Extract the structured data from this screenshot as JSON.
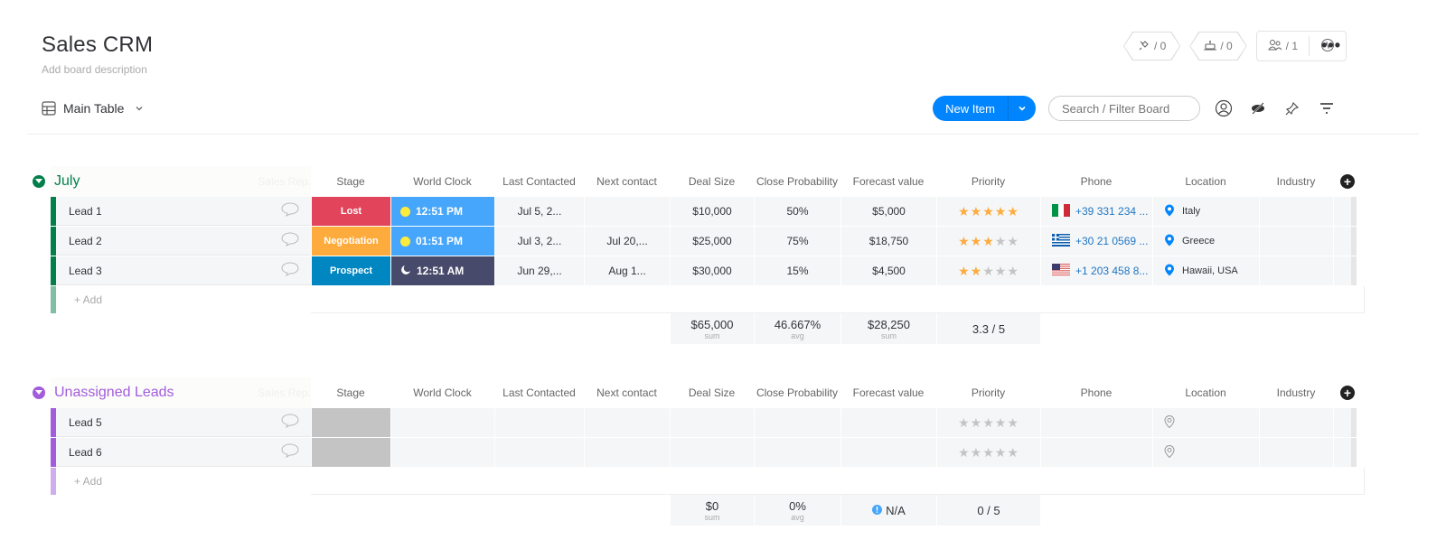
{
  "board": {
    "title": "Sales CRM",
    "description": "Add board description",
    "view": "Main Table"
  },
  "top_actions": {
    "integrations_count": "/ 0",
    "automations_count": "/ 0",
    "members_count": "/ 1"
  },
  "toolbar": {
    "new_item": "New Item",
    "search_placeholder": "Search / Filter Board"
  },
  "columns": [
    "Stage",
    "World Clock",
    "Last Contacted",
    "Next contact",
    "Deal Size",
    "Close Probability",
    "Forecast value",
    "Priority",
    "Phone",
    "Location",
    "Industry"
  ],
  "sales_rep_label": "Sales Rep.",
  "groups": [
    {
      "title": "July",
      "color": "#037f4c",
      "items": [
        {
          "name": "Lead 1",
          "stage": "Lost",
          "stage_color": "#e2445c",
          "clock": "12:51 PM",
          "clock_icon": "sun",
          "clock_color": "#46a6fb",
          "last_contacted": "Jul 5, 2...",
          "next_contact": "",
          "deal_size": "$10,000",
          "close_probability": "50%",
          "forecast": "$5,000",
          "priority": 5,
          "phone": "+39 331 234 ...",
          "flag": "italy",
          "location": "Italy"
        },
        {
          "name": "Lead 2",
          "stage": "Negotiation",
          "stage_color": "#fdab3d",
          "clock": "01:51 PM",
          "clock_icon": "sun",
          "clock_color": "#46a6fb",
          "last_contacted": "Jul 3, 2...",
          "next_contact": "Jul 20,...",
          "deal_size": "$25,000",
          "close_probability": "75%",
          "forecast": "$18,750",
          "priority": 3,
          "phone": "+30 21 0569 ...",
          "flag": "greece",
          "location": "Greece"
        },
        {
          "name": "Lead 3",
          "stage": "Prospect",
          "stage_color": "#0086c0",
          "clock": "12:51 AM",
          "clock_icon": "moon",
          "clock_color": "#484a6b",
          "last_contacted": "Jun 29,...",
          "next_contact": "Aug 1...",
          "deal_size": "$30,000",
          "close_probability": "15%",
          "forecast": "$4,500",
          "priority": 2,
          "phone": "+1 203 458 8...",
          "flag": "usa",
          "location": "Hawaii, USA"
        }
      ],
      "add_label": "+ Add",
      "summary": {
        "deal_size": "$65,000",
        "deal_size_fn": "sum",
        "close_probability": "46.667%",
        "close_probability_fn": "avg",
        "forecast": "$28,250",
        "forecast_fn": "sum",
        "priority": "3.3 / 5"
      }
    },
    {
      "title": "Unassigned Leads",
      "color": "#a25ddc",
      "items": [
        {
          "name": "Lead 5",
          "stage": "",
          "stage_color": "#c4c4c4",
          "priority": 0
        },
        {
          "name": "Lead 6",
          "stage": "",
          "stage_color": "#c4c4c4",
          "priority": 0
        }
      ],
      "add_label": "+ Add",
      "summary": {
        "deal_size": "$0",
        "deal_size_fn": "sum",
        "close_probability": "0%",
        "close_probability_fn": "avg",
        "forecast": "N/A",
        "forecast_fn": "",
        "priority": "0 / 5"
      }
    }
  ]
}
